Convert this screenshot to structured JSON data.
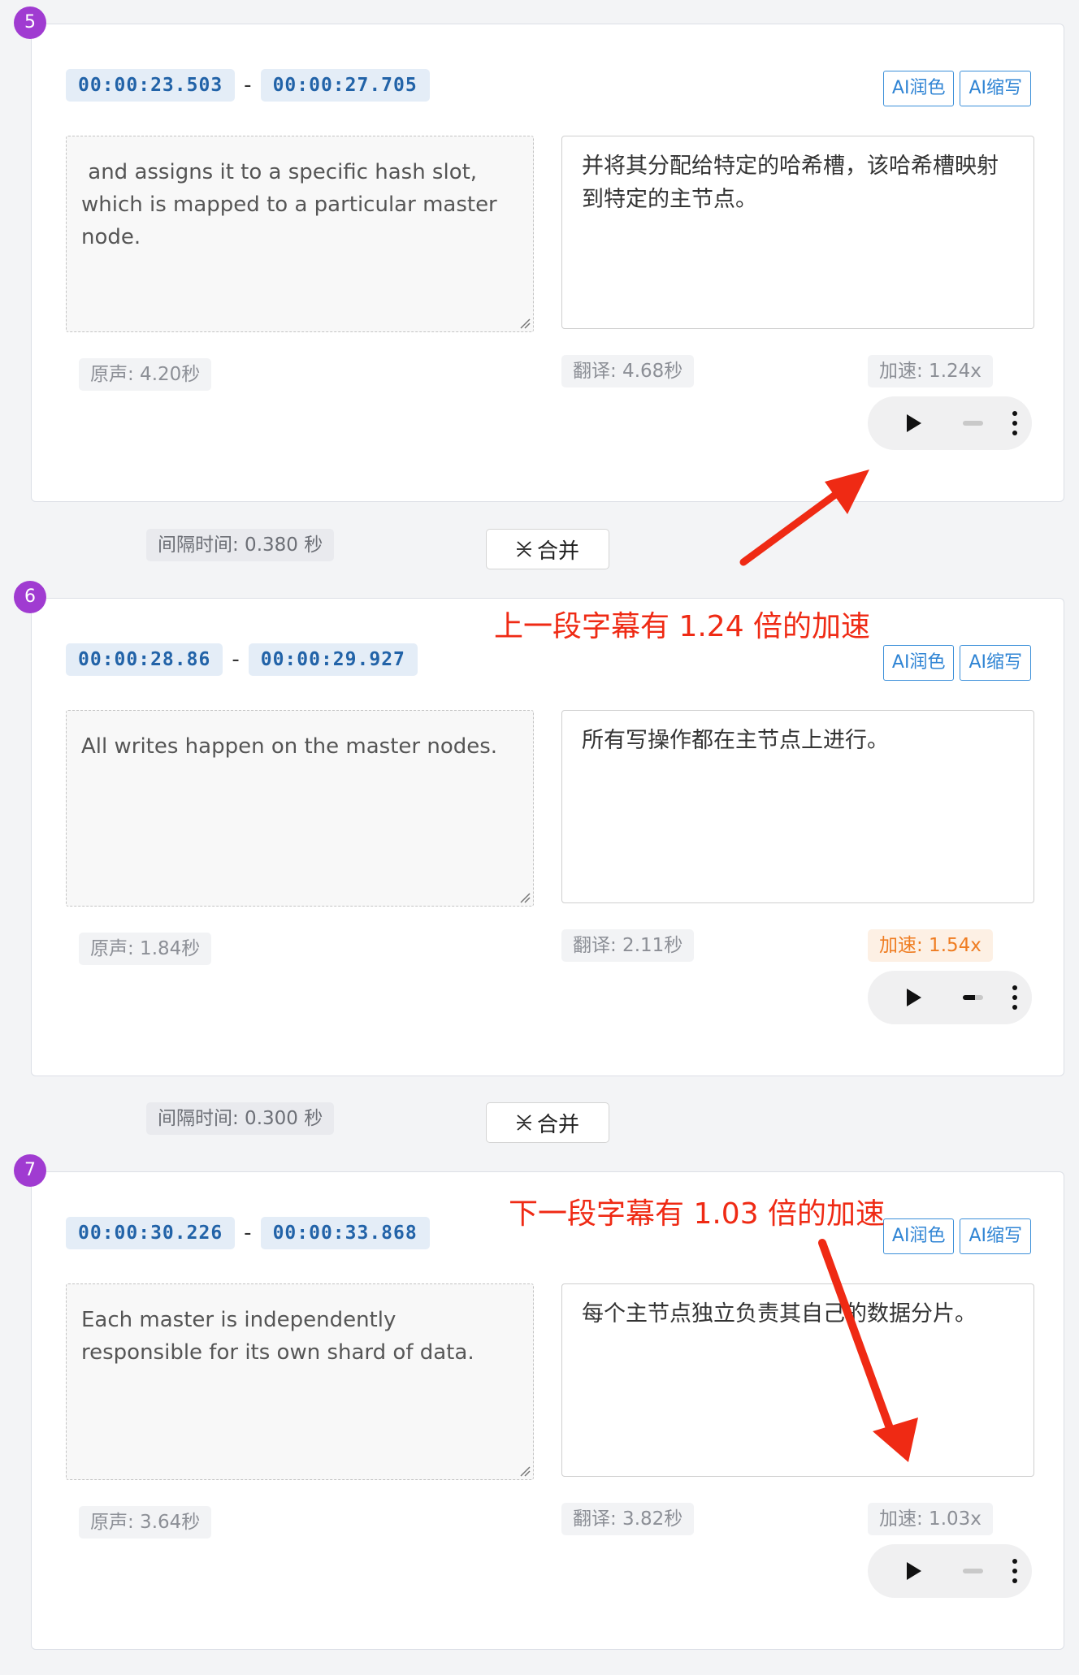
{
  "segments": [
    {
      "index": "5",
      "start": "00:00:23.503",
      "end": "00:00:27.705",
      "source_text": " and assigns it to a specific hash slot, which is mapped to a particular master node.",
      "translation": "并将其分配给特定的哈希槽，该哈希槽映射到特定的主节点。",
      "original_duration": "原声: 4.20秒",
      "translated_duration": "翻译: 4.68秒",
      "speedup": "加速: 1.24x",
      "speedup_warning": false,
      "volume_level": 0.0
    },
    {
      "index": "6",
      "start": "00:00:28.86",
      "end": "00:00:29.927",
      "source_text": "All writes happen on the master nodes.",
      "translation": "所有写操作都在主节点上进行。",
      "original_duration": "原声: 1.84秒",
      "translated_duration": "翻译: 2.11秒",
      "speedup": "加速: 1.54x",
      "speedup_warning": true,
      "volume_level": 0.6
    },
    {
      "index": "7",
      "start": "00:00:30.226",
      "end": "00:00:33.868",
      "source_text": "Each master is independently responsible for its own shard of data.",
      "translation": "每个主节点独立负责其自己的数据分片。",
      "original_duration": "原声: 3.64秒",
      "translated_duration": "翻译: 3.82秒",
      "speedup": "加速: 1.03x",
      "speedup_warning": false,
      "volume_level": 0.0
    }
  ],
  "ai_buttons": {
    "polish": "AI润色",
    "shorten": "AI缩写"
  },
  "gaps": [
    {
      "label": "间隔时间: 0.380 秒",
      "merge": "合并"
    },
    {
      "label": "间隔时间: 0.300 秒",
      "merge": "合并"
    }
  ],
  "annotations": {
    "previous": "上一段字幕有 1.24 倍的加速",
    "next": "下一段字幕有 1.03 倍的加速",
    "color": "#ef2a14"
  },
  "colors": {
    "index_badge": "#a03bd1",
    "time_tag_text": "#2263a8",
    "ai_button": "#2f84d4",
    "warning": "#ef7d22"
  }
}
